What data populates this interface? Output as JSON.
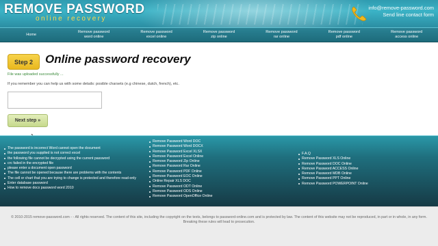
{
  "header": {
    "logo_main": "REMOVE PASSWORD",
    "logo_sub": "online recovery",
    "contact_email": "info@remove-password.com",
    "contact_phone": "Send line contact form",
    "icon": "phone-icon"
  },
  "nav": {
    "items": [
      {
        "line1": "Home",
        "line2": ""
      },
      {
        "line1": "Remove password",
        "line2": "word online"
      },
      {
        "line1": "Remove password",
        "line2": "excel online"
      },
      {
        "line1": "Remove password",
        "line2": "zip online"
      },
      {
        "line1": "Remove password",
        "line2": "rar online"
      },
      {
        "line1": "Remove password",
        "line2": "pdf online"
      },
      {
        "line1": "Remove password",
        "line2": "access online"
      }
    ]
  },
  "main": {
    "step_label": "Step 2",
    "title": "Online password recovery",
    "upload_message": "File was uploaded successfully ...",
    "hint": "If you remember you can help us with some details: posible charsets (e.g chinese, dutch, french), etc.",
    "details_value": "",
    "next_button": "Next step »"
  },
  "footer": {
    "col1": [
      "The password is incorrect Word cannot open the document",
      "the password you supplied is not correct excel",
      "the following file cannot be decrypted using the current password",
      "crc failed in the encrypted file",
      "please enter a document open password",
      "The file cannot be opened because there are problems with the contents",
      "The cell or chart that you are trying to change is protected and therefore read-only",
      "Enter database password",
      "How to remove docx password word 2010"
    ],
    "col2": [
      "Remove Password Word DOC",
      "Remove Password Word DOCX",
      "Remove Password Excel XLSX",
      "Remove Password Excel Online",
      "Remove Password Zip Online",
      "Remove Password Rar Online",
      "Remove Password PDF Online",
      "Remove Password EOC Online",
      "Online Repair XLS DOC",
      "Remove Password ODT Online",
      "Remove Password ODS Online",
      "Remove Password OpenOffice Online"
    ],
    "col3": [
      "F.A.Q",
      "Remove Password XLS Online",
      "Remove Password DOC Online",
      "Remove Password ACCESS Online",
      "Remove Password MDB Online",
      "Remove Password PPT Online",
      "Remove Password POWERPOINT Online"
    ]
  },
  "bottom": {
    "copyright_line1": "© 2010-2015 remove-password.com - - All rights reserved. The content of this site, including the copyright on the texts, belongs to password-online.com and is protected by law. The content of this website may not be reproduced, in part or in whole, in any form.",
    "copyright_line2": "Breaking these rules will lead to prosecution."
  },
  "colors": {
    "header_teal": "#3bb3c6",
    "nav_teal": "#1d6b7b",
    "step_yellow": "#f2c832",
    "button_green": "#d3e3a0",
    "success_green": "#3a8a3a"
  }
}
